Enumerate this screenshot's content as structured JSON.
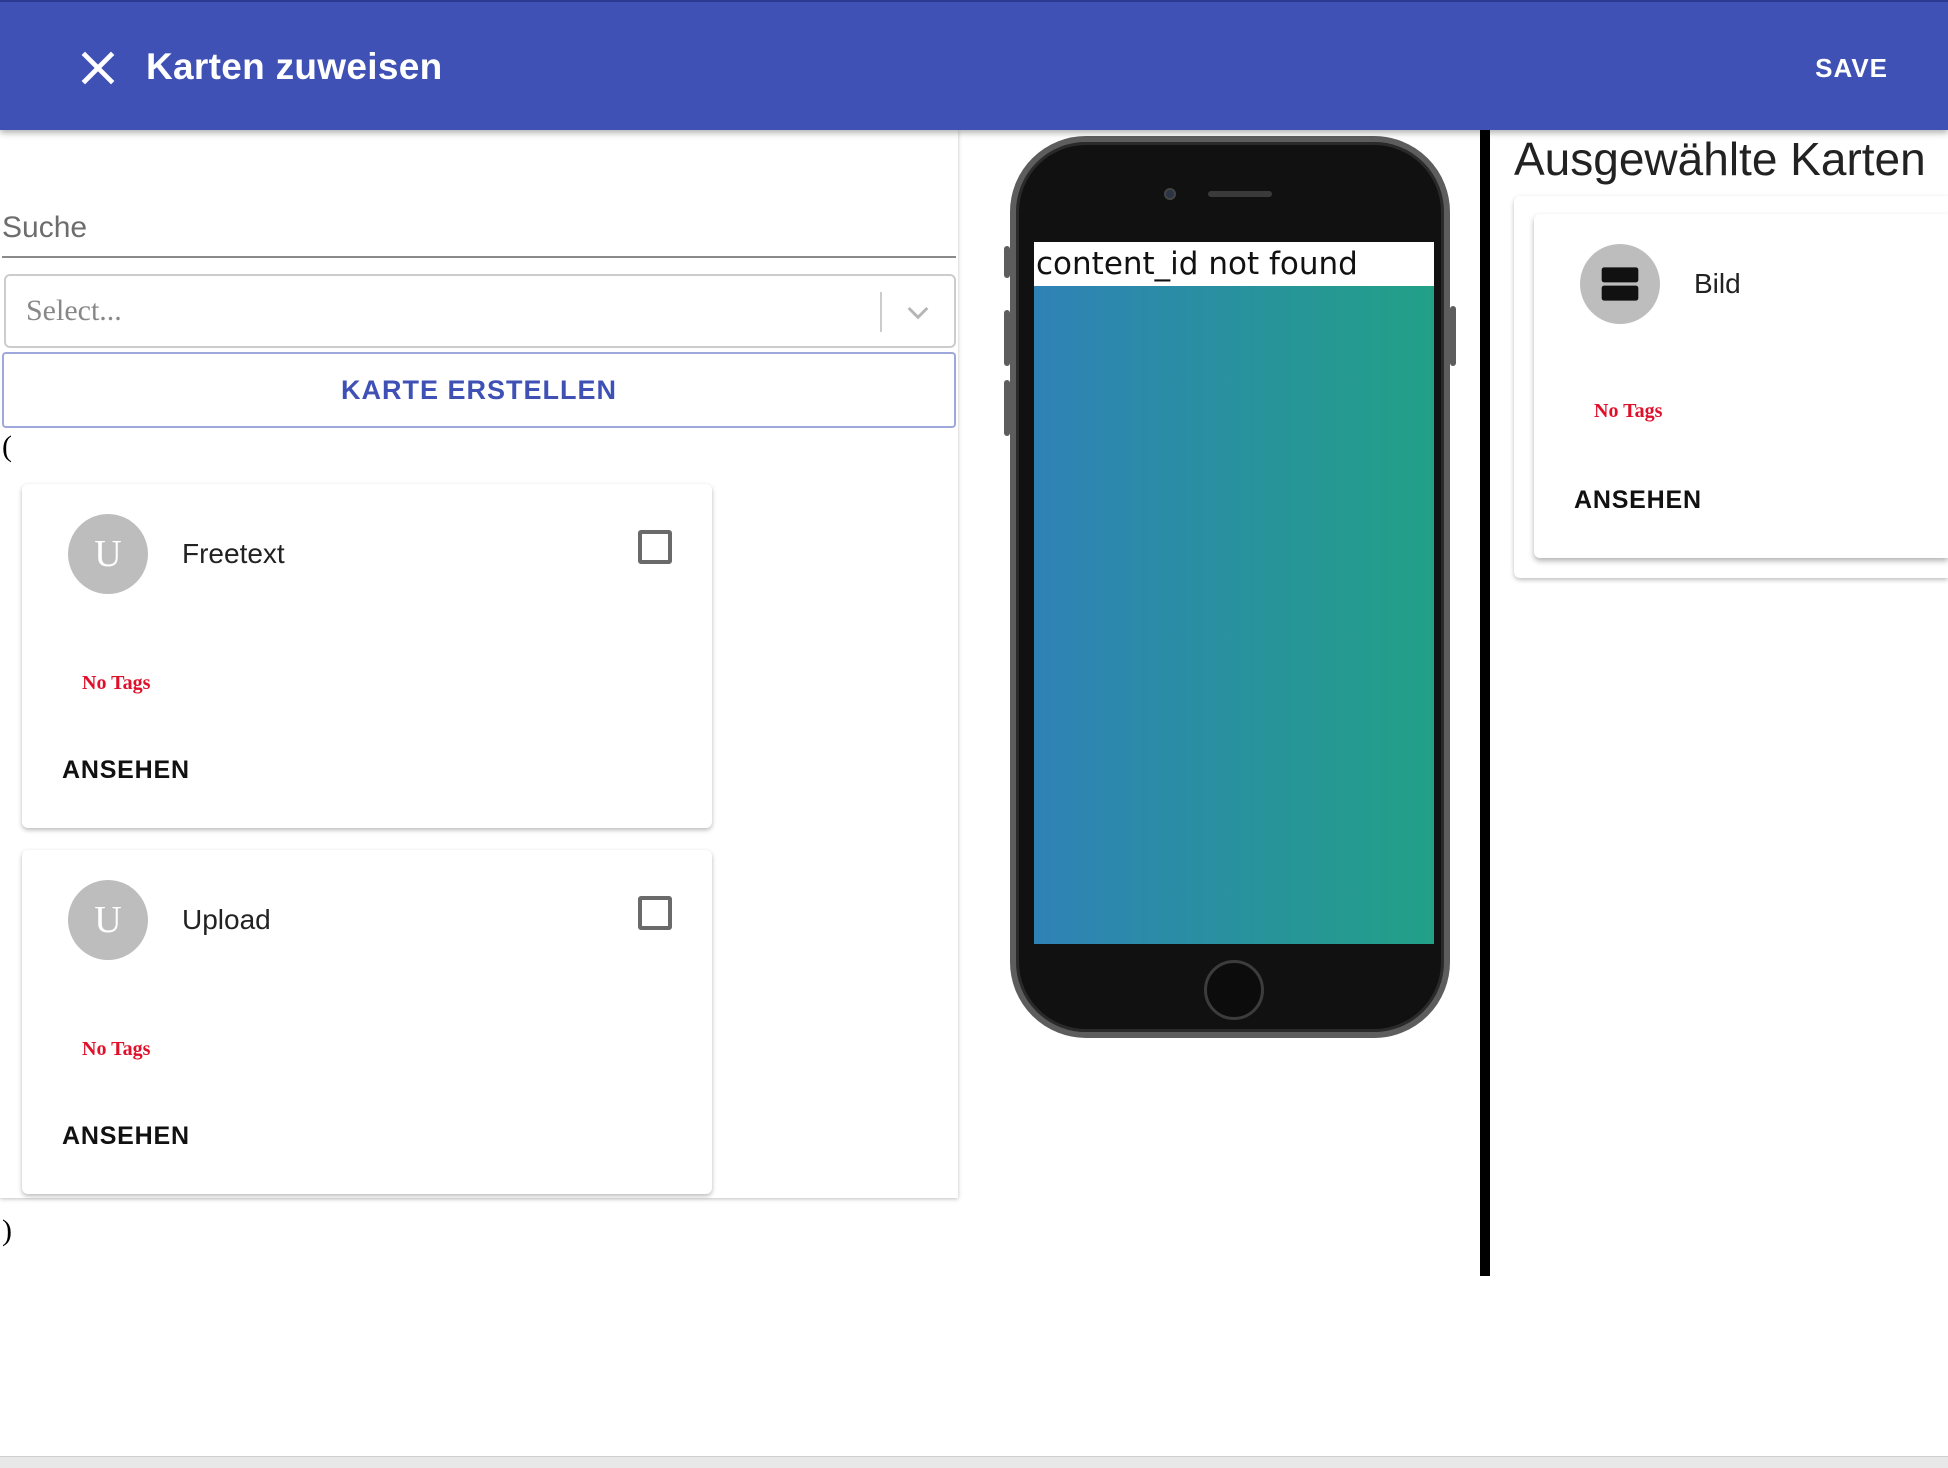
{
  "appbar": {
    "title": "Karten zuweisen",
    "save_label": "SAVE",
    "close_icon": "close-icon",
    "color": "#3f51b5"
  },
  "left": {
    "search_placeholder": "Suche",
    "select_placeholder": "Select...",
    "create_label": "KARTE ERSTELLEN",
    "open_paren": "(",
    "close_paren": ")",
    "cards": [
      {
        "avatar": "U",
        "title": "Freetext",
        "tags": "No Tags",
        "view_label": "ANSEHEN",
        "checked": false
      },
      {
        "avatar": "U",
        "title": "Upload",
        "tags": "No Tags",
        "view_label": "ANSEHEN",
        "checked": false
      }
    ]
  },
  "phone": {
    "screen_message": "content_id not found",
    "gradient": [
      "#2f82b6",
      "#22a087"
    ]
  },
  "right": {
    "title": "Ausgewählte Karten",
    "cards": [
      {
        "icon": "view-agenda-icon",
        "title": "Bild",
        "tags": "No Tags",
        "view_label": "ANSEHEN"
      }
    ]
  },
  "colors": {
    "accent": "#3f51b5",
    "tags": "#e0102b",
    "avatar": "#bdbdbd"
  }
}
